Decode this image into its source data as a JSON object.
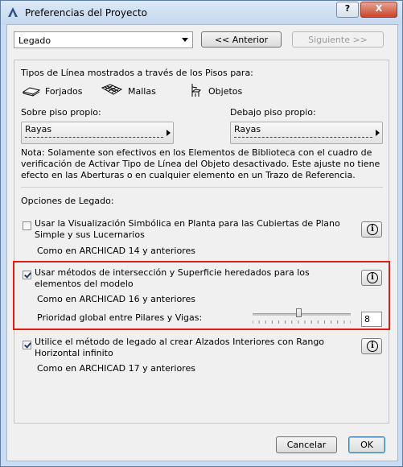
{
  "window": {
    "title": "Preferencias del Proyecto",
    "help_label": "?",
    "close_label": "X"
  },
  "nav": {
    "section_value": "Legado",
    "prev_label": "<< Anterior",
    "next_label": "Siguiente >>"
  },
  "line_types": {
    "heading": "Tipos de Línea mostrados a través de los Pisos para:",
    "items": [
      {
        "icon": "slab-icon",
        "label": "Forjados"
      },
      {
        "icon": "mesh-icon",
        "label": "Mallas"
      },
      {
        "icon": "chair-icon",
        "label": "Objetos"
      }
    ],
    "above_label": "Sobre piso propio:",
    "above_value": "Rayas",
    "below_label": "Debajo piso propio:",
    "below_value": "Rayas",
    "note": "Nota: Solamente son efectivos en los Elementos de Biblioteca con el cuadro de verificación de Activar Tipo de Línea del Objeto desactivado. Este ajuste no tiene efecto en las Aberturas o en cualquier elemento en un Trazo de Referencia."
  },
  "legacy": {
    "heading": "Opciones de Legado:",
    "options": [
      {
        "label": "Usar la Visualización Simbólica en Planta para las Cubiertas de Plano Simple y sus Lucernarios",
        "checked": false,
        "sub": "Como en ARCHICAD 14 y anteriores"
      },
      {
        "label": "Usar métodos de intersección y Superficie heredados para los elementos del modelo",
        "checked": true,
        "sub": "Como en ARCHICAD 16 y anteriores"
      },
      {
        "label": "Utilice el método de legado al crear Alzados Interiores con Rango Horizontal infinito",
        "checked": true,
        "sub": "Como en ARCHICAD 17 y anteriores"
      }
    ],
    "priority_label": "Prioridad global entre Pilares y Vigas:",
    "priority_value": "8",
    "priority_min": 1,
    "priority_max": 16,
    "info_label": "i"
  },
  "footer": {
    "cancel_label": "Cancelar",
    "ok_label": "OK"
  }
}
